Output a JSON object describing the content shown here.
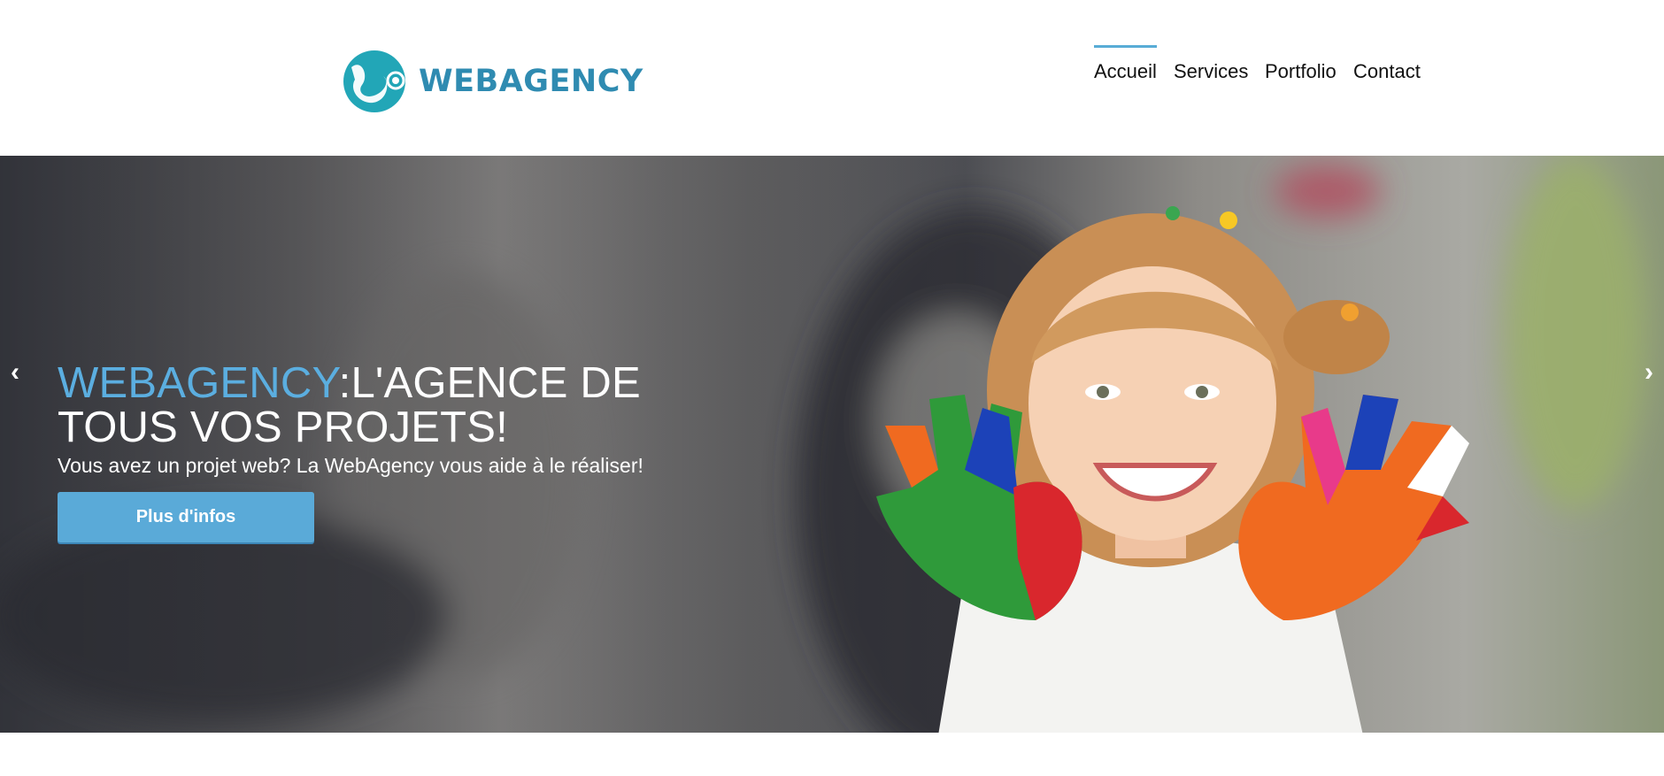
{
  "header": {
    "logo_text": "WEBAGENCY",
    "logo_color": "#2f8bb1",
    "logo_mark_color": "#22a6b7"
  },
  "nav": {
    "items": [
      {
        "label": "Accueil",
        "active": true
      },
      {
        "label": "Services",
        "active": false
      },
      {
        "label": "Portfolio",
        "active": false
      },
      {
        "label": "Contact",
        "active": false
      }
    ],
    "active_indicator_color": "#58acd6"
  },
  "hero": {
    "title_brand": "WEBAGENCY",
    "title_rest": ":L'AGENCE DE TOUS VOS PROJETS!",
    "subtitle": "Vous avez un projet web? La WebAgency vous aide à le réaliser!",
    "cta_label": "Plus d'infos",
    "brand_color": "#5baee0",
    "cta_color": "#5aaad8",
    "prev_icon": "chevron-left-icon",
    "next_icon": "chevron-right-icon",
    "prev_glyph": "‹",
    "next_glyph": "›"
  }
}
